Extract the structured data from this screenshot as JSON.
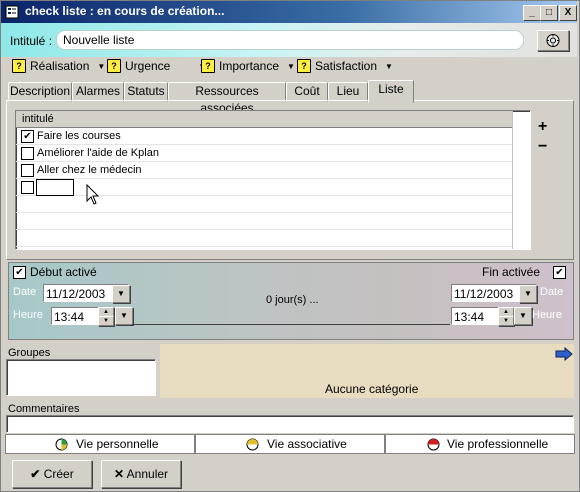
{
  "window": {
    "title": "check liste : en cours de création...",
    "controls": [
      "_",
      "□",
      "X"
    ]
  },
  "header": {
    "intitule_label": "Intitulé :",
    "intitule_value": "Nouvelle liste"
  },
  "priorities": [
    {
      "label": "Réalisation"
    },
    {
      "label": "Urgence"
    },
    {
      "label": "Importance"
    },
    {
      "label": "Satisfaction"
    }
  ],
  "tabs": [
    {
      "label": "Description"
    },
    {
      "label": "Alarmes"
    },
    {
      "label": "Statuts"
    },
    {
      "label": "Ressources associées"
    },
    {
      "label": "Coût"
    },
    {
      "label": "Lieu"
    },
    {
      "label": "Liste"
    }
  ],
  "liste": {
    "column_header": "intitulé",
    "rows": [
      {
        "label": "Faire les courses",
        "checked": true
      },
      {
        "label": "Améliorer l'aide de Kplan",
        "checked": false
      },
      {
        "label": "Aller chez le médecin",
        "checked": false
      },
      {
        "label": "",
        "checked": false
      }
    ],
    "add_symbol": "+",
    "remove_symbol": "−"
  },
  "dates": {
    "debut_label": "Début activé",
    "fin_label": "Fin activée",
    "date_label": "Date",
    "heure_label": "Heure",
    "start_date": "11/12/2003",
    "start_time": "13:44",
    "end_date": "11/12/2003",
    "end_time": "13:44",
    "duration": "0 jour(s) ..."
  },
  "groupes": {
    "label": "Groupes"
  },
  "categories": {
    "empty_text": "Aucune catégorie"
  },
  "commentaires": {
    "label": "Commentaires"
  },
  "life_tabs": [
    {
      "label": "Vie personnelle",
      "color": "#2e9e3a"
    },
    {
      "label": "Vie associative",
      "color": "#e0c030"
    },
    {
      "label": "Vie professionnelle",
      "color": "#d02020"
    }
  ],
  "buttons": {
    "create": "Créer",
    "cancel": "Annuler"
  }
}
